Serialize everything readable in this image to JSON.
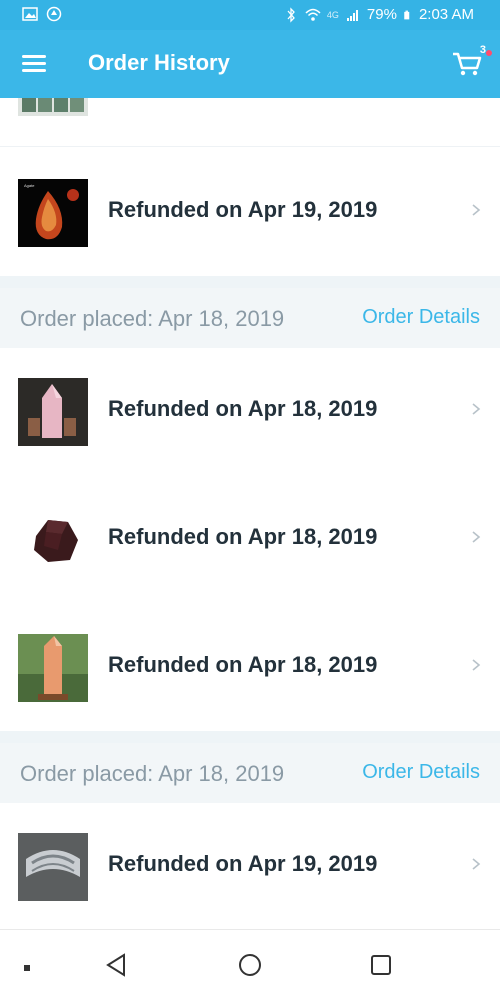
{
  "status_bar": {
    "battery": "79%",
    "time": "2:03 AM",
    "network": "4G"
  },
  "app_bar": {
    "title": "Order History",
    "cart_count": "3"
  },
  "groups": [
    {
      "items": [
        {
          "status": "Refunded on Apr 19, 2019",
          "thumb": "crystal-agate"
        }
      ]
    },
    {
      "placed": "Order placed: Apr 18, 2019",
      "details_label": "Order Details",
      "items": [
        {
          "status": "Refunded on Apr 18, 2019",
          "thumb": "rose-quartz-point"
        },
        {
          "status": "Refunded on Apr 18, 2019",
          "thumb": "garnet"
        },
        {
          "status": "Refunded on Apr 18, 2019",
          "thumb": "orange-obelisk"
        }
      ]
    },
    {
      "placed": "Order placed: Apr 18, 2019",
      "details_label": "Order Details",
      "items": [
        {
          "status": "Refunded on Apr 19, 2019",
          "thumb": "silver-bracelet"
        }
      ]
    }
  ],
  "colors": {
    "accent": "#3bb7e8",
    "status_bar": "#35b3e5",
    "text_primary": "#23313b",
    "text_muted": "#8a9aa5",
    "header_bg": "#f2f6f8"
  }
}
